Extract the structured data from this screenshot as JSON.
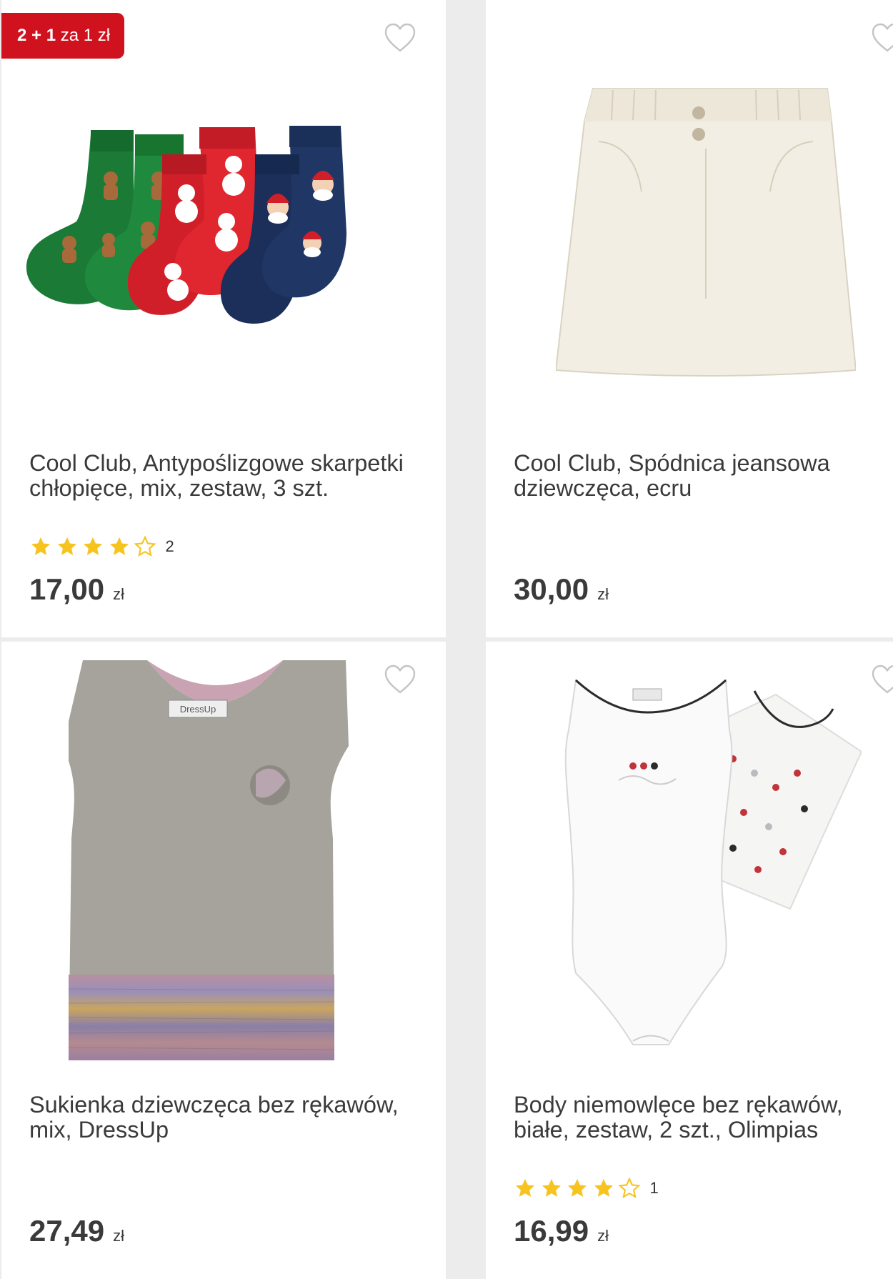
{
  "colors": {
    "accent": "#d0121f",
    "star": "#f7c41f",
    "price": "#3a3a3a"
  },
  "products": [
    {
      "badge": {
        "strong": "2 + 1",
        "rest": "za 1 zł"
      },
      "title": "Cool Club, Antypoślizgowe skarpetki chłopięce, mix, zestaw, 3 szt.",
      "rating": {
        "filled": 4,
        "total": 5,
        "count": "2"
      },
      "price": {
        "amount": "17,00",
        "currency": "zł"
      },
      "image": "socks-set",
      "favorite_icon": "heart-outline-icon"
    },
    {
      "title": "Cool Club, Spódnica jeansowa dziewczęca, ecru",
      "price": {
        "amount": "30,00",
        "currency": "zł"
      },
      "image": "ecru-skirt",
      "favorite_icon": "heart-outline-icon"
    },
    {
      "title": "Sukienka dziewczęca bez rękawów, mix, DressUp",
      "price": {
        "amount": "27,49",
        "currency": "zł"
      },
      "image": "grey-sleeveless-dress",
      "image_label": "DressUp",
      "favorite_icon": "heart-outline-icon"
    },
    {
      "title": "Body niemowlęce bez rękawów, białe, zestaw, 2 szt., Olimpias",
      "rating": {
        "filled": 4,
        "total": 5,
        "count": "1"
      },
      "price": {
        "amount": "16,99",
        "currency": "zł"
      },
      "image": "white-bodysuit-set",
      "favorite_icon": "heart-outline-icon"
    }
  ]
}
